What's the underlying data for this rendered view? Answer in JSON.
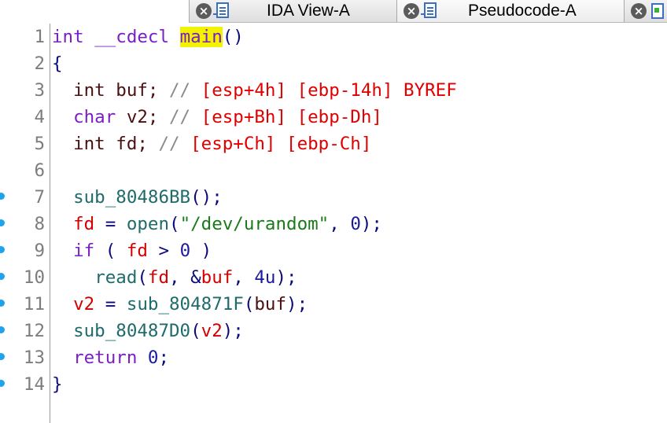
{
  "tabs": [
    {
      "label": "IDA View-A",
      "icon": "document-icon",
      "active": false
    },
    {
      "label": "Pseudocode-A",
      "icon": "document-icon",
      "active": true
    }
  ],
  "code": {
    "line_numbers": [
      "1",
      "2",
      "3",
      "4",
      "5",
      "6",
      "7",
      "8",
      "9",
      "10",
      "11",
      "12",
      "13",
      "14"
    ],
    "l1_type": "int",
    "l1_cc": "__cdecl",
    "l1_fn": "main",
    "l1_args": "()",
    "l2": "{",
    "l3_type": "int",
    "l3_var": "buf",
    "l3_semi": ";",
    "l3_cm": "//",
    "l3_c1": "[esp+4h]",
    "l3_c2": "[ebp-14h]",
    "l3_c3": "BYREF",
    "l4_type": "char",
    "l4_var": "v2",
    "l4_semi": ";",
    "l4_cm": "//",
    "l4_c1": "[esp+Bh]",
    "l4_c2": "[ebp-Dh]",
    "l5_type": "int",
    "l5_var": "fd",
    "l5_semi": ";",
    "l5_cm": "//",
    "l5_c1": "[esp+Ch]",
    "l5_c2": "[ebp-Ch]",
    "l7_fn": "sub_80486BB",
    "l7_rest": "();",
    "l8_var": "fd",
    "l8_eq": "=",
    "l8_fn": "open",
    "l8_p1": "(",
    "l8_str": "\"/dev/urandom\"",
    "l8_p2": ",",
    "l8_num": "0",
    "l8_p3": ");",
    "l9_kw": "if",
    "l9_p1": "(",
    "l9_var": "fd",
    "l9_op": ">",
    "l9_num": "0",
    "l9_p2": ")",
    "l10_fn": "read",
    "l10_p1": "(",
    "l10_var1": "fd",
    "l10_p2": ",",
    "l10_amp": "&",
    "l10_var2": "buf",
    "l10_p3": ",",
    "l10_num": "4u",
    "l10_p4": ");",
    "l11_var": "v2",
    "l11_eq": "=",
    "l11_fn": "sub_804871F",
    "l11_p1": "(",
    "l11_arg": "buf",
    "l11_p2": ");",
    "l12_fn": "sub_80487D0",
    "l12_p1": "(",
    "l12_arg": "v2",
    "l12_p2": ");",
    "l13_kw": "return",
    "l13_num": "0",
    "l13_semi": ";",
    "l14": "}"
  },
  "breakpoint_lines": [
    7,
    8,
    9,
    10,
    11,
    12,
    13,
    14
  ],
  "colors": {
    "keyword": "#7b1fc4",
    "variable": "#d40000",
    "function": "#1f6b6b",
    "comment": "#8a8a8a",
    "string": "#1a7a1a",
    "number": "#1a1a9c",
    "highlight": "#f3f300",
    "line_marker": "#1fa3ec"
  }
}
